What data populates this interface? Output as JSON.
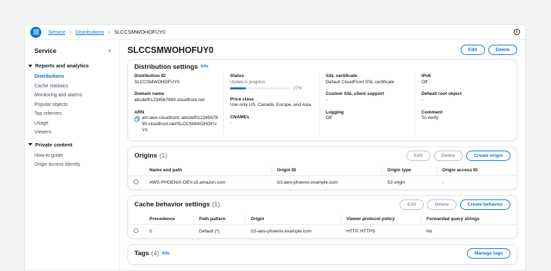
{
  "breadcrumb": {
    "service": "Service",
    "distributions": "Distributions",
    "current": "SLCCSMWOHOFUY0"
  },
  "sidebar": {
    "title": "Service",
    "sections": [
      {
        "title": "Reports and analytics",
        "items": [
          "Distributions",
          "Cache statistics",
          "Monitoring and alarms",
          "Popular objects",
          "Top referrers",
          "Usage",
          "Viewers"
        ]
      },
      {
        "title": "Private content",
        "items": [
          "How-to guide",
          "Origin access identity"
        ]
      }
    ],
    "active_item": "Distributions"
  },
  "page": {
    "title": "SLCCSMWOHOFUY0",
    "edit_label": "Edit",
    "delete_label": "Delete"
  },
  "settings": {
    "title": "Distribution settings",
    "info": "Info",
    "distribution_id_label": "Distribution ID",
    "distribution_id": "SLCCSMWOHOFUY0",
    "domain_label": "Domain name",
    "domain": "abcdef01234567890.cloudfront.net",
    "arn_label": "ARN",
    "arn": "arn:aws:cloudfront::abcdef01234567890.cloudfront.net/SLCCSMWOHOFUY0",
    "status_label": "Status",
    "status": "Update in progress",
    "progress_percent": 27,
    "progress_text": "27%",
    "price_class_label": "Price class",
    "price_class": "Use only US, Canada, Europe, and Asia",
    "cnames_label": "CNAMEs",
    "cnames": "-",
    "ssl_label": "SSL certificate",
    "ssl": "Default CloudFront SSL certificate",
    "custom_ssl_label": "Custom SSL client support",
    "custom_ssl": "-",
    "logging_label": "Logging",
    "logging": "Off",
    "ipv6_label": "IPv6",
    "ipv6": "Off",
    "root_object_label": "Default root object",
    "root_object": "-",
    "comment_label": "Comment",
    "comment": "To verify"
  },
  "origins": {
    "title": "Origins",
    "count": "(1)",
    "edit_label": "Edit",
    "delete_label": "Delete",
    "create_label": "Create origin",
    "columns": [
      "Name and path",
      "Origin ID",
      "Origin type",
      "Origin access ID"
    ],
    "rows": [
      [
        "AWS-PHOENIX-DEV.s3.amazon.com",
        "S3-aws-phoenix.example.com",
        "S3 origin",
        "-"
      ]
    ]
  },
  "behaviors": {
    "title": "Cache behavior settings",
    "count": "(1)",
    "edit_label": "Edit",
    "delete_label": "Delete",
    "create_label": "Create behavior",
    "columns": [
      "Precedence",
      "Path pattern",
      "Origin",
      "Viewer protocol policy",
      "Forwarded query strings"
    ],
    "rows": [
      [
        "0",
        "Default (*)",
        "S3-aws-phoenix.example.com",
        "HTTP, HTTPS",
        "No"
      ]
    ]
  },
  "tags": {
    "title": "Tags",
    "count": "(4)",
    "info": "Info",
    "manage_label": "Manage tags"
  },
  "colors": {
    "accent": "#0972d3",
    "text": "#16191f",
    "muted": "#5f6b7a",
    "border": "#e9ebed",
    "background": "#f2f3f3"
  }
}
